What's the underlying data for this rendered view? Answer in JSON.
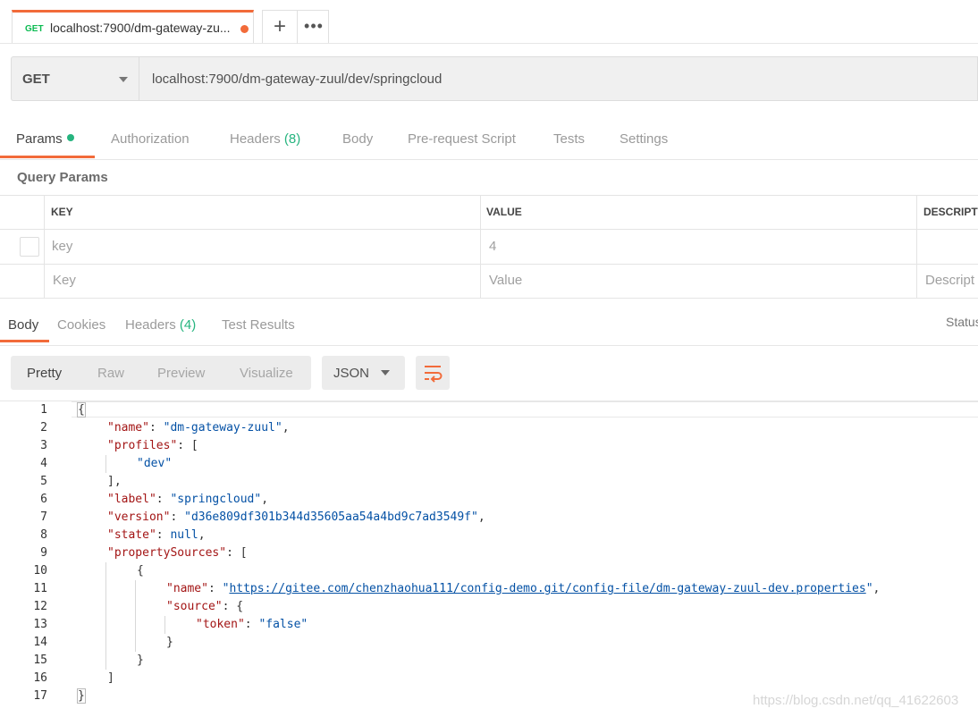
{
  "tab": {
    "method": "GET",
    "title": "localhost:7900/dm-gateway-zu..."
  },
  "tab_actions": {
    "add": "+",
    "more": "•••"
  },
  "request": {
    "method": "GET",
    "url": "localhost:7900/dm-gateway-zuul/dev/springcloud"
  },
  "request_tabs": [
    {
      "label": "Params",
      "count": ""
    },
    {
      "label": "Authorization",
      "count": ""
    },
    {
      "label": "Headers",
      "count": "(8)"
    },
    {
      "label": "Body",
      "count": ""
    },
    {
      "label": "Pre-request Script",
      "count": ""
    },
    {
      "label": "Tests",
      "count": ""
    },
    {
      "label": "Settings",
      "count": ""
    }
  ],
  "query_params": {
    "title": "Query Params",
    "columns": [
      "KEY",
      "VALUE",
      "DESCRIPTI"
    ],
    "rows": [
      {
        "key": "key",
        "value": "4",
        "description": ""
      }
    ],
    "new_row": {
      "key": "Key",
      "value": "Value",
      "description": "Descript"
    }
  },
  "response_tabs": [
    {
      "label": "Body",
      "count": ""
    },
    {
      "label": "Cookies",
      "count": ""
    },
    {
      "label": "Headers",
      "count": "(4)"
    },
    {
      "label": "Test Results",
      "count": ""
    }
  ],
  "status_label": "Status",
  "view_modes": [
    "Pretty",
    "Raw",
    "Preview",
    "Visualize"
  ],
  "language": "JSON",
  "code_lines": [
    "{",
    "\"name\": \"dm-gateway-zuul\",",
    "\"profiles\": [",
    "\"dev\"",
    "],",
    "\"label\": \"springcloud\",",
    "\"version\": \"d36e809df301b344d35605aa54a4bd9c7ad3549f\",",
    "\"state\": null,",
    "\"propertySources\": [",
    "{",
    "\"name\": \"https://gitee.com/chenzhaohua111/config-demo.git/config-file/dm-gateway-zuul-dev.properties\",",
    "\"source\": {",
    "\"token\": \"false\"",
    "}",
    "}",
    "]",
    "}"
  ],
  "json": {
    "name": "dm-gateway-zuul",
    "profiles": [
      "dev"
    ],
    "label": "springcloud",
    "version": "d36e809df301b344d35605aa54a4bd9c7ad3549f",
    "state": "null",
    "property_source_name": "https://gitee.com/chenzhaohua111/config-demo.git/config-file/dm-gateway-zuul-dev.properties",
    "source_token": "false"
  },
  "line_numbers": [
    "1",
    "2",
    "3",
    "4",
    "5",
    "6",
    "7",
    "8",
    "9",
    "10",
    "11",
    "12",
    "13",
    "14",
    "15",
    "16",
    "17"
  ],
  "watermark": "https://blog.csdn.net/qq_41622603",
  "colors": {
    "accent": "#f26b3a",
    "success": "#26b47f",
    "method_get": "#0cbb52",
    "json_key": "#a31515",
    "json_string": "#0451a5"
  }
}
